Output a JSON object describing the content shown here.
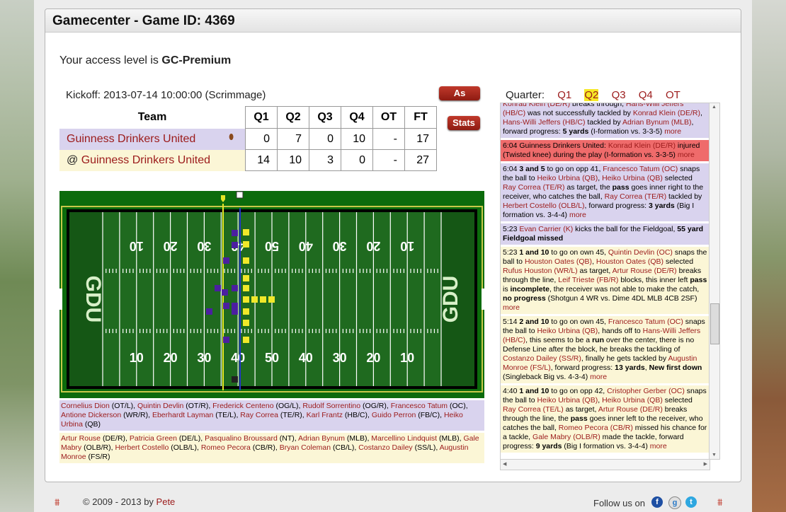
{
  "header": {
    "title": "Gamecenter - Game ID: 4369"
  },
  "access": {
    "prefix": "Your access level is ",
    "level": "GC-Premium"
  },
  "kickoff": "Kickoff: 2013-07-14 10:00:00 (Scrimmage)",
  "buttons": {
    "as_live": "As Live",
    "stats": "Stats"
  },
  "scoreboard": {
    "headers": [
      "Team",
      "Q1",
      "Q2",
      "Q3",
      "Q4",
      "OT",
      "FT"
    ],
    "rows": [
      {
        "team": "Guinness Drinkers United",
        "prefix": "",
        "scores": [
          "0",
          "7",
          "0",
          "10",
          "-",
          "17"
        ]
      },
      {
        "team": "Guinness Drinkers United",
        "prefix": "@ ",
        "scores": [
          "14",
          "10",
          "3",
          "0",
          "-",
          "27"
        ]
      }
    ]
  },
  "field": {
    "endzone_left": "GDU",
    "endzone_right": "GDU",
    "yard_numbers": [
      "10",
      "20",
      "30",
      "40",
      "50",
      "40",
      "30",
      "20",
      "10"
    ]
  },
  "lineups": {
    "offense": [
      {
        "name": "Cornelius Dion",
        "pos": " (OT/L), "
      },
      {
        "name": "Quintin Devlin",
        "pos": " (OT/R), "
      },
      {
        "name": "Frederick Centeno",
        "pos": " (OG/L), "
      },
      {
        "name": "Rudolf Sorrentino",
        "pos": " (OG/R), "
      },
      {
        "name": "Francesco Tatum",
        "pos": " (OC), "
      },
      {
        "name": "Antione Dickerson",
        "pos": " (WR/R), "
      },
      {
        "name": "Eberhardt Layman",
        "pos": " (TE/L), "
      },
      {
        "name": "Ray Correa",
        "pos": " (TE/R), "
      },
      {
        "name": "Karl Frantz",
        "pos": " (HB/C), "
      },
      {
        "name": "Guido Perron",
        "pos": " (FB/C), "
      },
      {
        "name": "Heiko Urbina",
        "pos": " (QB)"
      }
    ],
    "defense": [
      {
        "name": "Artur Rouse",
        "pos": " (DE/R), "
      },
      {
        "name": "Patricia Green",
        "pos": " (DE/L), "
      },
      {
        "name": "Pasqualino Broussard",
        "pos": " (NT), "
      },
      {
        "name": "Adrian Bynum",
        "pos": " (MLB), "
      },
      {
        "name": "Marcellino Lindquist",
        "pos": " (MLB), "
      },
      {
        "name": "Gale Mabry",
        "pos": " (OLB/R), "
      },
      {
        "name": "Herbert Costello",
        "pos": " (OLB/L), "
      },
      {
        "name": "Romeo Pecora",
        "pos": " (CB/R), "
      },
      {
        "name": "Bryan Coleman",
        "pos": " (CB/L), "
      },
      {
        "name": "Costanzo Dailey",
        "pos": " (SS/L), "
      },
      {
        "name": "Augustin Monroe",
        "pos": " (FS/R)"
      }
    ]
  },
  "quarters": {
    "label": "Quarter:",
    "items": [
      "Q1",
      "Q2",
      "Q3",
      "Q4",
      "OT"
    ],
    "selected": "Q2"
  },
  "plays": [
    {
      "color": "purple",
      "html": "<span class='lnk'>Konrad Klein (DE/R)</span> breaks through, <span class='lnk'>Hans-Willi Jeffers (HB/C)</span> was not successfully tackled by <span class='lnk'>Konrad Klein (DE/R)</span>, <span class='lnk'>Hans-Willi Jeffers (HB/C)</span> tackled by <span class='lnk'>Adrian Bynum (MLB)</span>, forward progress: <b>5 yards</b> (I-formation vs. 3-3-5) <span class='more'>more</span>"
    },
    {
      "color": "red",
      "html": "6:04 Guinness Drinkers United: <span class='lnk'>Konrad Klein (DE/R)</span> injured (Twisted knee) during the play (I-formation vs. 3-3-5) <span class='more'>more</span>"
    },
    {
      "color": "purple",
      "html": "6:04 <b>3 and 5</b> to go on opp 41, <span class='lnk'>Francesco Tatum (OC)</span> snaps the ball to <span class='lnk'>Heiko Urbina (QB)</span>, <span class='lnk'>Heiko Urbina (QB)</span> selected <span class='lnk'>Ray Correa (TE/R)</span> as target, the <b>pass</b> goes inner right to the receiver, who catches the ball, <span class='lnk'>Ray Correa (TE/R)</span> tackled by <span class='lnk'>Herbert Costello (OLB/L)</span>, forward progress: <b>3 yards</b> (Big I formation vs. 3-4-4) <span class='more'>more</span>"
    },
    {
      "color": "purple",
      "html": "5:23 <span class='lnk'>Evan Carrier (K)</span> kicks the ball for the Fieldgoal, <b>55 yard Fieldgoal missed</b>"
    },
    {
      "color": "yellow",
      "html": "5:23 <b>1 and 10</b> to go on own 45, <span class='lnk'>Quintin Devlin (OC)</span> snaps the ball to <span class='lnk'>Houston Oates (QB)</span>, <span class='lnk'>Houston Oates (QB)</span> selected <span class='lnk'>Rufus Houston (WR/L)</span> as target, <span class='lnk'>Artur Rouse (DE/R)</span> breaks through the line, <span class='lnk'>Leif Trieste (FB/R)</span> blocks, this inner left <b>pass</b> is <b>incomplete</b>, the receiver was not able to make the catch, <b>no progress</b> (Shotgun 4 WR vs. Dime 4DL MLB 4CB 2SF) <span class='more'>more</span>"
    },
    {
      "color": "yellow",
      "html": "5:14 <b>2 and 10</b> to go on own 45, <span class='lnk'>Francesco Tatum (OC)</span> snaps the ball to <span class='lnk'>Heiko Urbina (QB)</span>, hands off to <span class='lnk'>Hans-Willi Jeffers (HB/C)</span>, this seems to be a <b>run</b> over the center, there is no Defense Line after the block, he breaks the tackling of <span class='lnk'>Costanzo Dailey (SS/R)</span>, finally he gets tackled by <span class='lnk'>Augustin Monroe (FS/L)</span>, forward progress: <b>13 yards</b>, <b>New first down</b> (Singleback Big vs. 4-3-4) <span class='more'>more</span>"
    },
    {
      "color": "yellow",
      "html": "4:40 <b>1 and 10</b> to go on opp 42, <span class='lnk'>Cristopher Gerber (OC)</span> snaps the ball to <span class='lnk'>Heiko Urbina (QB)</span>, <span class='lnk'>Heiko Urbina (QB)</span> selected <span class='lnk'>Ray Correa (TE/L)</span> as target, <span class='lnk'>Artur Rouse (DE/R)</span> breaks through the line, the <b>pass</b> goes inner left to the receiver, who catches the ball, <span class='lnk'>Romeo Pecora (CB/R)</span> missed his chance for a tackle, <span class='lnk'>Gale Mabry (OLB/R)</span> made the tackle, forward progress: <b>9 yards</b> (Big I formation vs. 3-4-4) <span class='more'>more</span>"
    }
  ],
  "footer": {
    "copy": "© 2009 - 2013 by ",
    "author": "Pete",
    "follow": "Follow us on"
  },
  "colors": {
    "link": "#9b1a1a",
    "offense_bg": "#d9d3ee",
    "defense_bg": "#fbf6d6",
    "injury_bg": "#ef6b6b",
    "button_red": "#a32617",
    "field_green": "#1f6a1f",
    "offense_marker": "#4b1fa0",
    "defense_marker": "#f0e82a"
  }
}
